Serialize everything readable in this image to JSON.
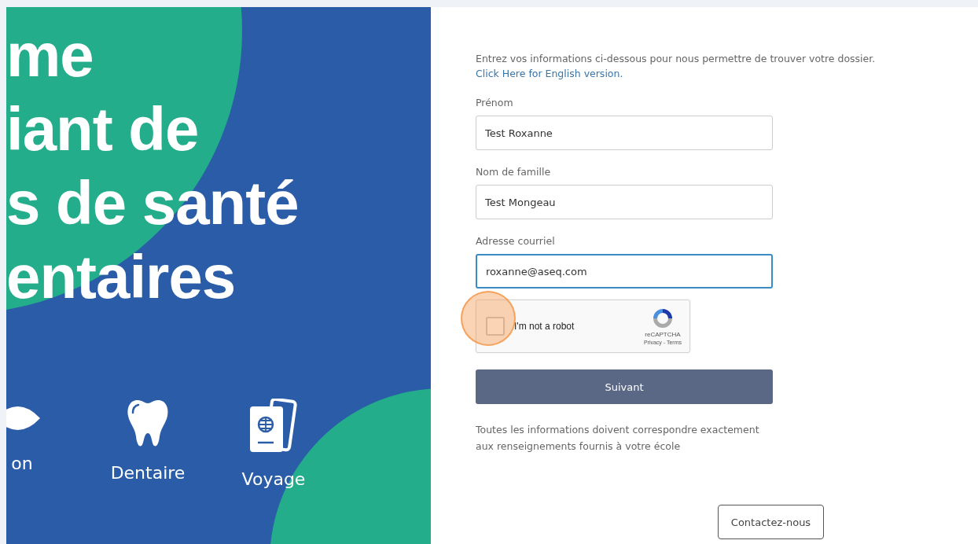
{
  "banner": {
    "headline_lines": [
      "me",
      "iant de",
      "s de santé",
      "entaires"
    ],
    "categories": [
      {
        "kind": "eye",
        "label": "on"
      },
      {
        "kind": "tooth",
        "label": "Dentaire"
      },
      {
        "kind": "passport",
        "label": "Voyage"
      }
    ]
  },
  "form": {
    "intro": "Entrez vos informations ci-dessous pour nous permettre de trouver votre dossier.",
    "english_link": "Click Here for English version.",
    "fields": [
      {
        "label": "Prénom",
        "value": "Test Roxanne",
        "focused": false
      },
      {
        "label": "Nom de famille",
        "value": "Test Mongeau",
        "focused": false
      },
      {
        "label": "Adresse courriel",
        "value": "roxanne@aseq.com",
        "focused": true
      }
    ],
    "captcha": {
      "label": "I'm not a robot",
      "checked": false,
      "brand": "reCAPTCHA",
      "links": "Privacy - Terms",
      "click_marker": true
    },
    "submit": "Suivant",
    "note": "Toutes les informations doivent correspondre exactement aux renseignements fournis à votre école",
    "contact_button": "Contactez-nous"
  }
}
